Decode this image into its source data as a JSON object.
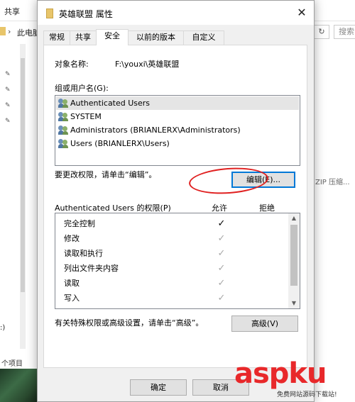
{
  "explorer": {
    "share_tab": "共享",
    "breadcrumb": "此电脑",
    "search_placeholder": "搜索",
    "zip_text": "ZIP 压缩...",
    "left_label": ":)",
    "status_text": "个项目"
  },
  "dialog": {
    "title": "英雄联盟 属性",
    "tabs": [
      "常规",
      "共享",
      "安全",
      "以前的版本",
      "自定义"
    ],
    "active_tab": "安全",
    "object_name_label": "对象名称:",
    "object_name_value": "F:\\youxi\\英雄联盟",
    "group_label": "组或用户名(G):",
    "users": [
      {
        "name": "Authenticated Users",
        "selected": true,
        "icon": "group-users-icon"
      },
      {
        "name": "SYSTEM",
        "selected": false,
        "icon": "group-users-icon"
      },
      {
        "name": "Administrators (BRIANLERX\\Administrators)",
        "selected": false,
        "icon": "group-users-icon"
      },
      {
        "name": "Users (BRIANLERX\\Users)",
        "selected": false,
        "icon": "group-users-icon"
      }
    ],
    "change_perm_text": "要更改权限，请单击“编辑”。",
    "edit_button": "编辑(E)...",
    "perm_header": "Authenticated Users 的权限(P)",
    "allow_header": "允许",
    "deny_header": "拒绝",
    "permissions": [
      {
        "name": "完全控制",
        "allow": "✓",
        "style": "dark"
      },
      {
        "name": "修改",
        "allow": "✓",
        "style": "light"
      },
      {
        "name": "读取和执行",
        "allow": "✓",
        "style": "light"
      },
      {
        "name": "列出文件夹内容",
        "allow": "✓",
        "style": "light"
      },
      {
        "name": "读取",
        "allow": "✓",
        "style": "light"
      },
      {
        "name": "写入",
        "allow": "✓",
        "style": "light"
      }
    ],
    "advanced_text": "有关特殊权限或高级设置，请单击“高级”。",
    "advanced_button": "高级(V)",
    "ok_button": "确定",
    "cancel_button": "取消",
    "close_glyph": "✕"
  },
  "watermark": {
    "brand": "aspku",
    "sub": "免费网站源码下载站!"
  }
}
